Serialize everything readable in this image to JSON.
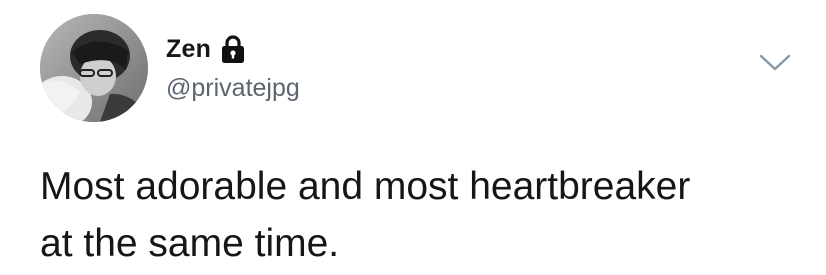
{
  "author": {
    "display_name": "Zen",
    "handle": "@privatejpg",
    "protected_icon": "lock-icon",
    "avatar_icon": "profile-photo"
  },
  "menu": {
    "icon": "chevron-down-icon"
  },
  "tweet": {
    "text_line1": "Most adorable and most heartbreaker",
    "text_line2": "at the same time."
  },
  "colors": {
    "text": "#14171a",
    "handle": "#5b6670",
    "chevron": "#8899a6",
    "background": "#ffffff"
  }
}
